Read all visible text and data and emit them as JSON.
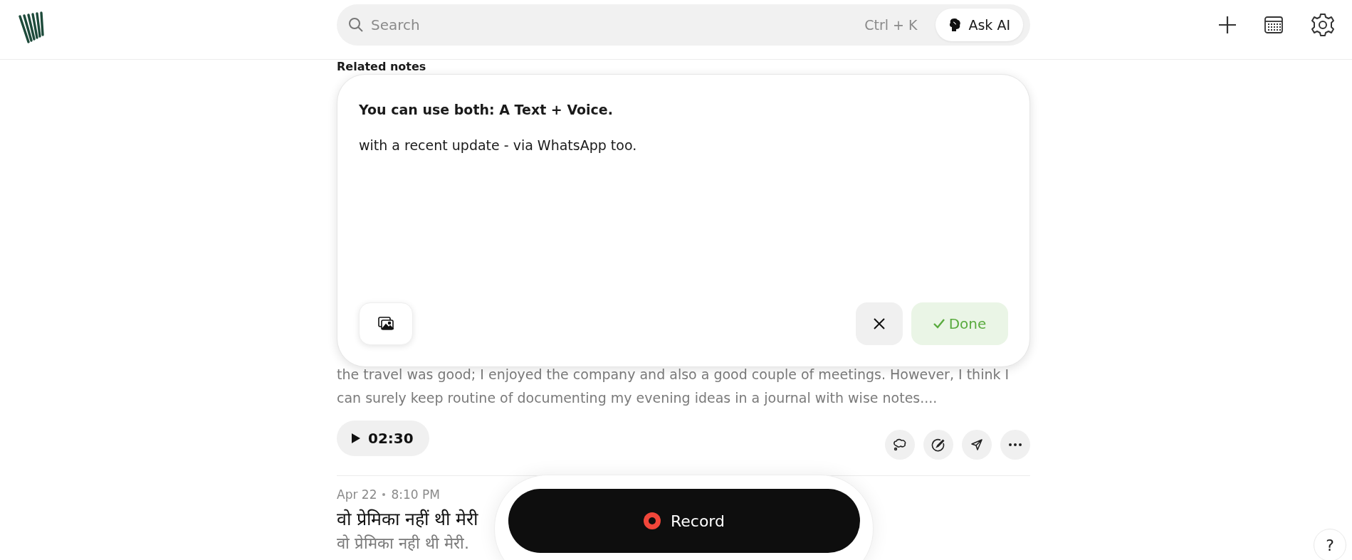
{
  "header": {
    "search": {
      "placeholder": "Search",
      "shortcut": "Ctrl + K"
    },
    "ask_ai": "Ask AI"
  },
  "related_notes": {
    "heading": "Related notes"
  },
  "editor": {
    "title": "You can use both: A Text + Voice.",
    "body": "with a recent update - via WhatsApp too.",
    "done": "Done"
  },
  "notes": [
    {
      "kind": "audio",
      "excerpt": "the travel was good; I enjoyed the company and also a good couple of meetings. However, I think I can surely keep routine of documenting my evening ideas in a journal with wise notes....",
      "duration": "02:30"
    },
    {
      "kind": "text",
      "date": "Apr 22",
      "time": "8:10 PM",
      "title": "वो प्रेमिका नहीं थी मेरी",
      "excerpt": "वो प्रेमिका नही थी मेरी."
    }
  ],
  "record": {
    "label": "Record"
  },
  "help": "?"
}
